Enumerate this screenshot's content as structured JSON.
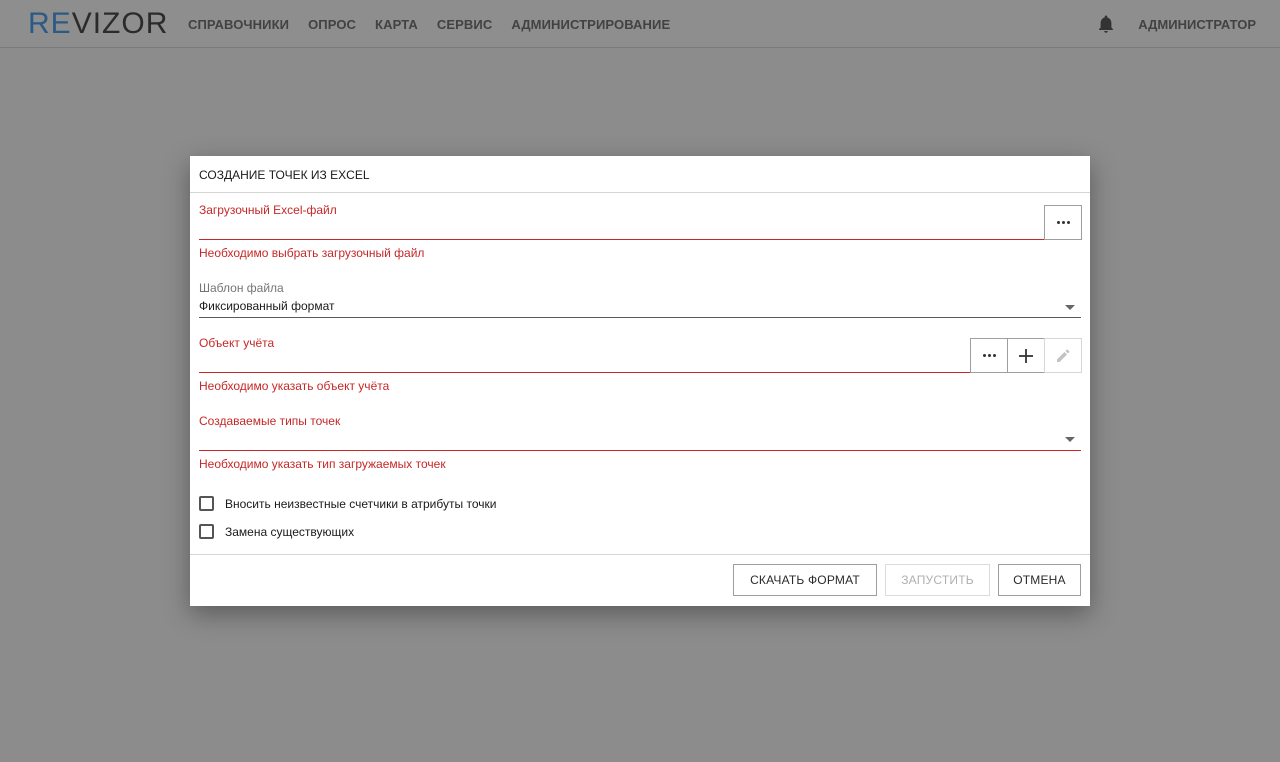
{
  "header": {
    "logo_re": "RE",
    "logo_vizor": "VIZOR",
    "nav": [
      "СПРАВОЧНИКИ",
      "ОПРОС",
      "КАРТА",
      "СЕРВИС",
      "АДМИНИСТРИРОВАНИЕ"
    ],
    "notifications_icon": "bell-icon",
    "user": "АДМИНИСТРАТОР"
  },
  "dialog": {
    "title": "СОЗДАНИЕ ТОЧЕК ИЗ EXCEL",
    "file_field": {
      "label": "Загрузочный Excel-файл",
      "value": "",
      "error": "Необходимо выбрать загрузочный файл",
      "browse_icon": "more-horiz-icon"
    },
    "template_field": {
      "label": "Шаблон файла",
      "value": "Фиксированный формат",
      "arrow_icon": "dropdown-arrow-icon"
    },
    "object_field": {
      "label": "Объект учёта",
      "value": "",
      "error": "Необходимо указать объект учёта",
      "browse_icon": "more-horiz-icon",
      "add_icon": "plus-icon",
      "edit_icon": "pencil-icon"
    },
    "point_types_field": {
      "label": "Создаваемые типы точек",
      "value": "",
      "error": "Необходимо указать тип загружаемых точек",
      "arrow_icon": "dropdown-arrow-icon"
    },
    "checkboxes": [
      {
        "label": "Вносить неизвестные счетчики в атрибуты точки",
        "checked": false
      },
      {
        "label": "Замена существующих",
        "checked": false
      }
    ],
    "buttons": {
      "download": "СКАЧАТЬ ФОРМАТ",
      "run": "ЗАПУСТИТЬ",
      "cancel": "ОТМЕНА"
    }
  },
  "colors": {
    "error": "#c62828",
    "overlay": "#8c8c8c",
    "logo_accent": "#2b5a86"
  }
}
